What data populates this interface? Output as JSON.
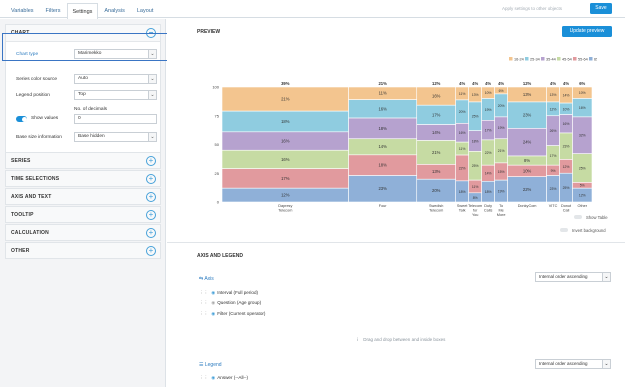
{
  "tabs": [
    {
      "label": "Variables"
    },
    {
      "label": "Filters"
    },
    {
      "label": "Settings"
    },
    {
      "label": "Analysis"
    },
    {
      "label": "Layout"
    }
  ],
  "apply_link": "Apply settings to other objects",
  "save_label": "Save",
  "sidebar": {
    "chart_section": {
      "title": "CHART",
      "chart_type_label": "Chart type",
      "chart_type_value": "Marimekko",
      "series_color_label": "Series color source",
      "series_color_value": "Auto",
      "legend_position_label": "Legend position",
      "legend_position_value": "Top",
      "show_values_label": "Show values",
      "decimals_label": "No. of decimals",
      "decimals_value": "0",
      "base_size_label": "Base size information",
      "base_size_value": "Base hidden"
    },
    "collapsed_sections": [
      "SERIES",
      "TIME SELECTIONS",
      "AXIS AND TEXT",
      "TOOLTIP",
      "CALCULATION",
      "OTHER"
    ]
  },
  "main": {
    "preview_title": "PREVIEW",
    "update_label": "Update preview",
    "show_table_label": "Show Table",
    "invert_bg_label": "Invert background",
    "axis_legend_title": "AXIS AND LEGEND",
    "axis_label": "Axis",
    "axis_order": "Internal order ascending",
    "axis_items": [
      "Interval (Full period)",
      "Question (Age group)",
      "Filter (Current operator)"
    ],
    "drag_hint": "Drag and drop between and inside boxes",
    "legend_label": "Legend",
    "legend_order": "Internal order ascending",
    "legend_items": [
      "Answer (--All--)"
    ]
  },
  "chart_data": {
    "type": "marimekko",
    "y_ticks": [
      "100",
      "75",
      "50",
      "25",
      "0"
    ],
    "ylim": [
      0,
      100
    ],
    "series_names": [
      "16-24",
      "25-34",
      "35-44",
      "45-54",
      "55-64",
      "65+"
    ],
    "colors": [
      "#f3c58f",
      "#8fcce0",
      "#b6a2cf",
      "#c6dba3",
      "#e19a9e",
      "#8fb0d8"
    ],
    "columns": [
      {
        "label": "Dapresy Telecom",
        "width_pct": "39%",
        "width": 39,
        "values": [
          21,
          18,
          16,
          16,
          17,
          12
        ],
        "labels": [
          "21%",
          "18%",
          "16%",
          "16%",
          "17%",
          "12%"
        ]
      },
      {
        "label": "Four",
        "width_pct": "21%",
        "width": 21,
        "values": [
          11,
          16,
          18,
          14,
          18,
          23
        ],
        "labels": [
          "11%",
          "16%",
          "18%",
          "14%",
          "18%",
          "23%"
        ]
      },
      {
        "label": "Swedish Telecom",
        "width_pct": "12%",
        "width": 12,
        "values": [
          16,
          17,
          14,
          21,
          13,
          20
        ],
        "labels": [
          "16%",
          "17%",
          "14%",
          "21%",
          "13%",
          "20%"
        ]
      },
      {
        "label": "Sweet Talk",
        "width_pct": "4%",
        "width": 4,
        "values": [
          11,
          20,
          16,
          11,
          22,
          18
        ],
        "labels": [
          "11%",
          "20%",
          "16%",
          "11%",
          "22%",
          "18%"
        ]
      },
      {
        "label": "Telecom for You",
        "width_pct": "4%",
        "width": 4,
        "values": [
          13,
          25,
          18,
          25,
          11,
          8
        ],
        "labels": [
          "13%",
          "25%",
          "18%",
          "25%",
          "11%",
          "8%"
        ]
      },
      {
        "label": "Duty Calls",
        "width_pct": "4%",
        "width": 4,
        "values": [
          10,
          19,
          17,
          22,
          14,
          18
        ],
        "labels": [
          "10%",
          "19%",
          "17%",
          "22%",
          "14%",
          "18%"
        ]
      },
      {
        "label": "To Me More",
        "width_pct": "4%",
        "width": 4,
        "values": [
          6,
          20,
          19,
          21,
          15,
          19
        ],
        "labels": [
          "6%",
          "20%",
          "19%",
          "21%",
          "15%",
          "19%"
        ]
      },
      {
        "label": "DonkyCom",
        "width_pct": "12%",
        "width": 12,
        "values": [
          13,
          23,
          24,
          8,
          10,
          22
        ],
        "labels": [
          "13%",
          "23%",
          "24%",
          "8%",
          "10%",
          "22%"
        ]
      },
      {
        "label": "VITC",
        "width_pct": "4%",
        "width": 4,
        "values": [
          13,
          12,
          26,
          17,
          9,
          23
        ],
        "labels": [
          "13%",
          "12%",
          "26%",
          "17%",
          "9%",
          "23%"
        ]
      },
      {
        "label": "Donut Call",
        "width_pct": "4%",
        "width": 4,
        "values": [
          14,
          10,
          16,
          23,
          12,
          25
        ],
        "labels": [
          "14%",
          "10%",
          "16%",
          "23%",
          "12%",
          "25%"
        ]
      },
      {
        "label": "Other",
        "width_pct": "6%",
        "width": 6,
        "values": [
          10,
          16,
          32,
          25,
          5,
          12
        ],
        "labels": [
          "10%",
          "16%",
          "32%",
          "25%",
          "5%",
          "12%"
        ]
      }
    ]
  }
}
